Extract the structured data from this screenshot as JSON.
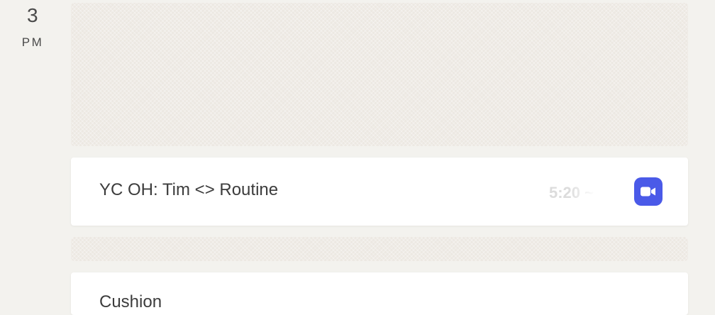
{
  "time_gutter": {
    "hour": "3",
    "period": "PM"
  },
  "events": [
    {
      "title": "YC OH: Tim <> Routine",
      "time": "5:20 ~",
      "action_icon": "video-camera-icon",
      "action_color": "#4a5ae8"
    },
    {
      "title": "Cushion"
    }
  ]
}
